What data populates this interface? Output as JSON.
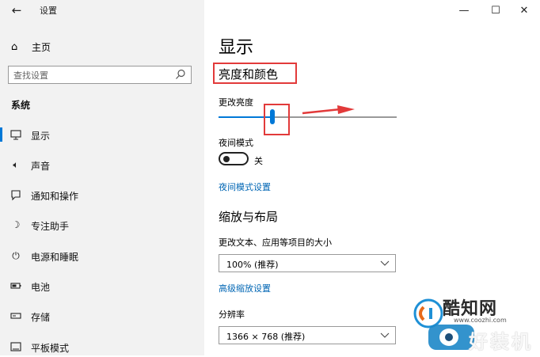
{
  "window": {
    "title": "设置",
    "controls": {
      "minimize": "—",
      "maximize": "☐",
      "close": "✕"
    }
  },
  "sidebar": {
    "home_label": "主页",
    "search_placeholder": "查找设置",
    "section_header": "系统",
    "items": [
      {
        "label": "显示",
        "icon": "monitor-icon",
        "active": true
      },
      {
        "label": "声音",
        "icon": "speaker-icon",
        "active": false
      },
      {
        "label": "通知和操作",
        "icon": "notification-icon",
        "active": false
      },
      {
        "label": "专注助手",
        "icon": "moon-icon",
        "active": false
      },
      {
        "label": "电源和睡眠",
        "icon": "power-icon",
        "active": false
      },
      {
        "label": "电池",
        "icon": "battery-icon",
        "active": false
      },
      {
        "label": "存储",
        "icon": "storage-icon",
        "active": false
      },
      {
        "label": "平板模式",
        "icon": "tablet-icon",
        "active": false
      }
    ]
  },
  "main": {
    "page_title": "显示",
    "brightness_section_title": "亮度和颜色",
    "brightness_label": "更改亮度",
    "brightness_value": 0.3,
    "night_mode_label": "夜间模式",
    "night_mode_state": "关",
    "night_mode_settings_link": "夜间模式设置",
    "scale_section_title": "缩放与布局",
    "text_size_label": "更改文本、应用等项目的大小",
    "scale_value": "100% (推荐)",
    "advanced_scale_link": "高级缩放设置",
    "resolution_label": "分辨率",
    "resolution_value": "1366 × 768 (推荐)"
  },
  "watermark": {
    "brand1": "酷知网",
    "url": "www.coozhi.com",
    "brand2": "好装机"
  },
  "colors": {
    "accent": "#0078d7",
    "annotation_red": "#e23a3a",
    "sidebar_bg": "#f2f2f2",
    "link": "#0066b4"
  }
}
